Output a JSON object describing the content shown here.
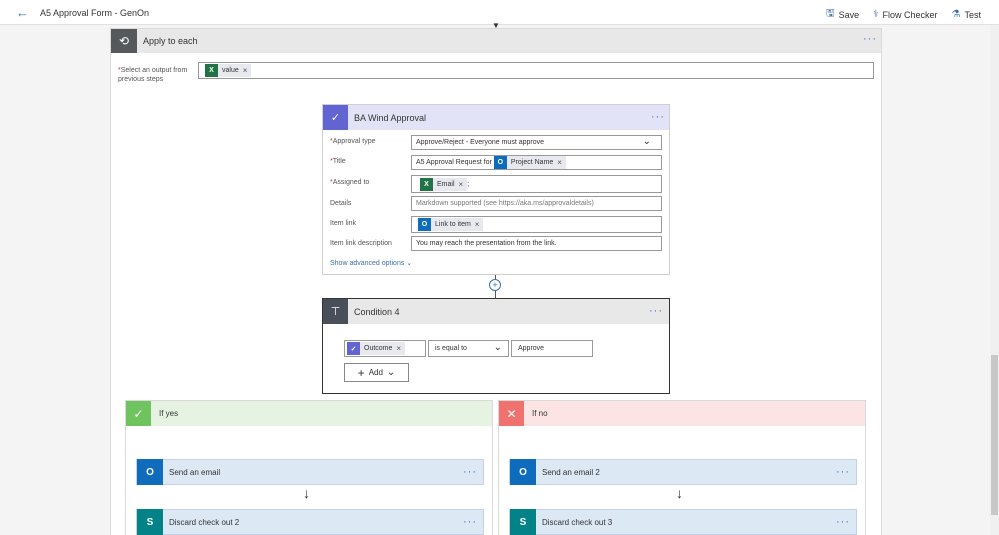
{
  "header": {
    "back_icon": "←",
    "title": "A5 Approval Form - GenOn",
    "actions": [
      {
        "icon": "save-icon",
        "label": "Save"
      },
      {
        "icon": "stethoscope-icon",
        "label": "Flow Checker"
      },
      {
        "icon": "flask-icon",
        "label": "Test"
      }
    ]
  },
  "apply_each": {
    "title": "Apply to each",
    "select_label": "Select an output from previous steps",
    "token": "value"
  },
  "approval": {
    "title": "BA Wind Approval",
    "fields": [
      {
        "label": "Approval type",
        "required": true,
        "value": "Approve/Reject - Everyone must approve"
      },
      {
        "label": "Title",
        "required": true,
        "prefix": "A5 Approval Request for",
        "token": "Project Name"
      },
      {
        "label": "Assigned to",
        "required": true,
        "token": "Email",
        "suffix": ";"
      },
      {
        "label": "Details",
        "required": false,
        "placeholder": "Markdown supported (see https://aka.ms/approvaldetails)"
      },
      {
        "label": "Item link",
        "required": false,
        "token": "Link to item"
      },
      {
        "label": "Item link description",
        "required": false,
        "value": "You may reach the presentation from the link."
      }
    ],
    "show_advanced": "Show advanced options"
  },
  "condition": {
    "title": "Condition 4",
    "left_token": "Outcome",
    "operator": "is equal to",
    "right_value": "Approve",
    "add_label": "Add"
  },
  "branches": {
    "yes": {
      "title": "If yes",
      "actions": [
        "Send an email",
        "Discard check out 2"
      ]
    },
    "no": {
      "title": "If no",
      "actions": [
        "Send an email 2",
        "Discard check out 3"
      ]
    }
  },
  "colors": {
    "accent": "#3a6fb2",
    "approval": "#6264d1",
    "yes": "#6fc460",
    "no": "#f0726e",
    "excel": "#217346",
    "outlook": "#0f6cbd",
    "sharepoint": "#038387"
  }
}
